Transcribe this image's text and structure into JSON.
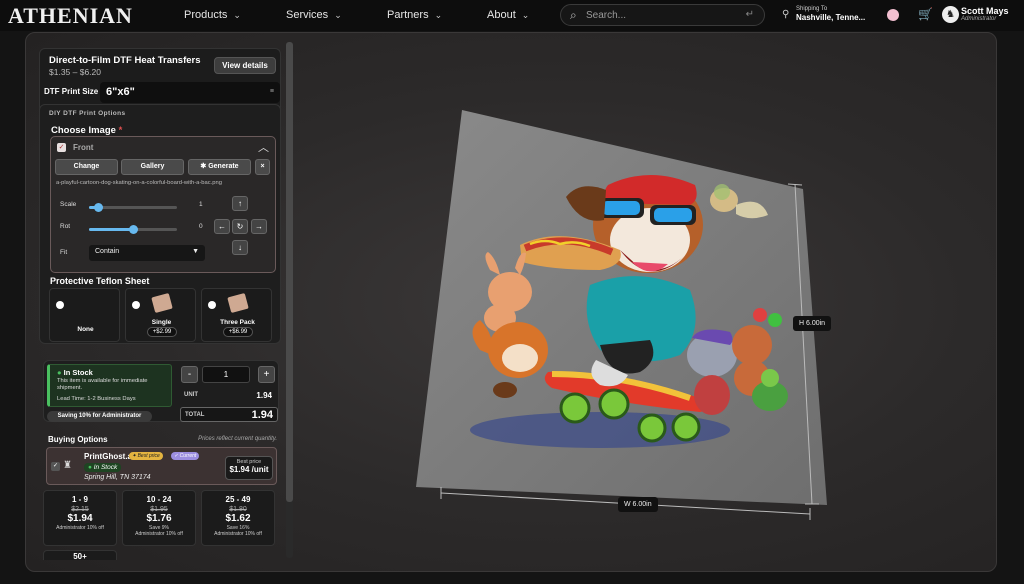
{
  "nav": {
    "logo": "ATHENIAN",
    "items": [
      {
        "label": "Products"
      },
      {
        "label": "Services"
      },
      {
        "label": "Partners"
      },
      {
        "label": "About"
      }
    ],
    "search_placeholder": "Search...",
    "shipping_label": "Shipping To",
    "shipping_location": "Nashville, Tenne...",
    "user_name": "Scott Mays",
    "user_role": "Administrator"
  },
  "product": {
    "title": "Direct-to-Film DTF Heat Transfers",
    "price_range": "$1.35 – $6.20",
    "view_details": "View details",
    "size_label": "DTF Print Size",
    "size_value": "6\"x6\""
  },
  "options": {
    "section_label": "DIY DTF Print Options",
    "choose_image": "Choose Image",
    "required_mark": "*",
    "front_label": "Front",
    "buttons": {
      "change": "Change",
      "gallery": "Gallery",
      "generate": "Generate",
      "close": "×"
    },
    "filename": "a-playful-cartoon-dog-skating-on-a-colorful-board-with-a-bac.png",
    "scale_label": "Scale",
    "scale_value": "1",
    "scale_fraction": 0.1,
    "rot_label": "Rot",
    "rot_value": "0",
    "rot_fraction": 0.5,
    "fit_label": "Fit",
    "fit_value": "Contain"
  },
  "teflon": {
    "title": "Protective Teflon Sheet",
    "options": [
      {
        "name": "None",
        "price": ""
      },
      {
        "name": "Single",
        "price": "+$2.99"
      },
      {
        "name": "Three Pack",
        "price": "+$6.99"
      }
    ]
  },
  "stock": {
    "heading": "In Stock",
    "desc": "This item is available for immediate shipment.",
    "lead": "Lead Time: 1-2 Business Days",
    "saving": "Saving 10% for Administrator",
    "qty": "1",
    "minus": "-",
    "plus": "+",
    "unit_label": "UNIT",
    "unit_price": "1.94",
    "total_label": "TOTAL",
    "total_price": "1.94"
  },
  "buying": {
    "title": "Buying Options",
    "note": "Prices reflect current quantity.",
    "vendor": {
      "name": "PrintGhost.ai",
      "best_badge": "Best price",
      "current_badge": "Current",
      "stock": "In Stock",
      "location": "Spring Hill, TN 37174",
      "best_label": "Best price",
      "best_value": "$1.94 /unit"
    },
    "tiers": [
      {
        "range": "1 - 9",
        "old": "$2.15",
        "price": "$1.94",
        "save": "",
        "admin": "Administrator 10% off"
      },
      {
        "range": "10 - 24",
        "old": "$1.95",
        "price": "$1.76",
        "save": "Save 9%",
        "admin": "Administrator 10% off"
      },
      {
        "range": "25 - 49",
        "old": "$1.80",
        "price": "$1.62",
        "save": "Save 16%",
        "admin": "Administrator 10% off"
      }
    ],
    "tier_more": "50+"
  },
  "mockup": {
    "height_label": "H 6.00in",
    "width_label": "W 6.00in"
  },
  "colors": {
    "accent_blue": "#67b9ef",
    "in_stock_green": "#4ac060",
    "best_price_gold": "#e4b440",
    "current_purple": "#9c8ee0"
  }
}
